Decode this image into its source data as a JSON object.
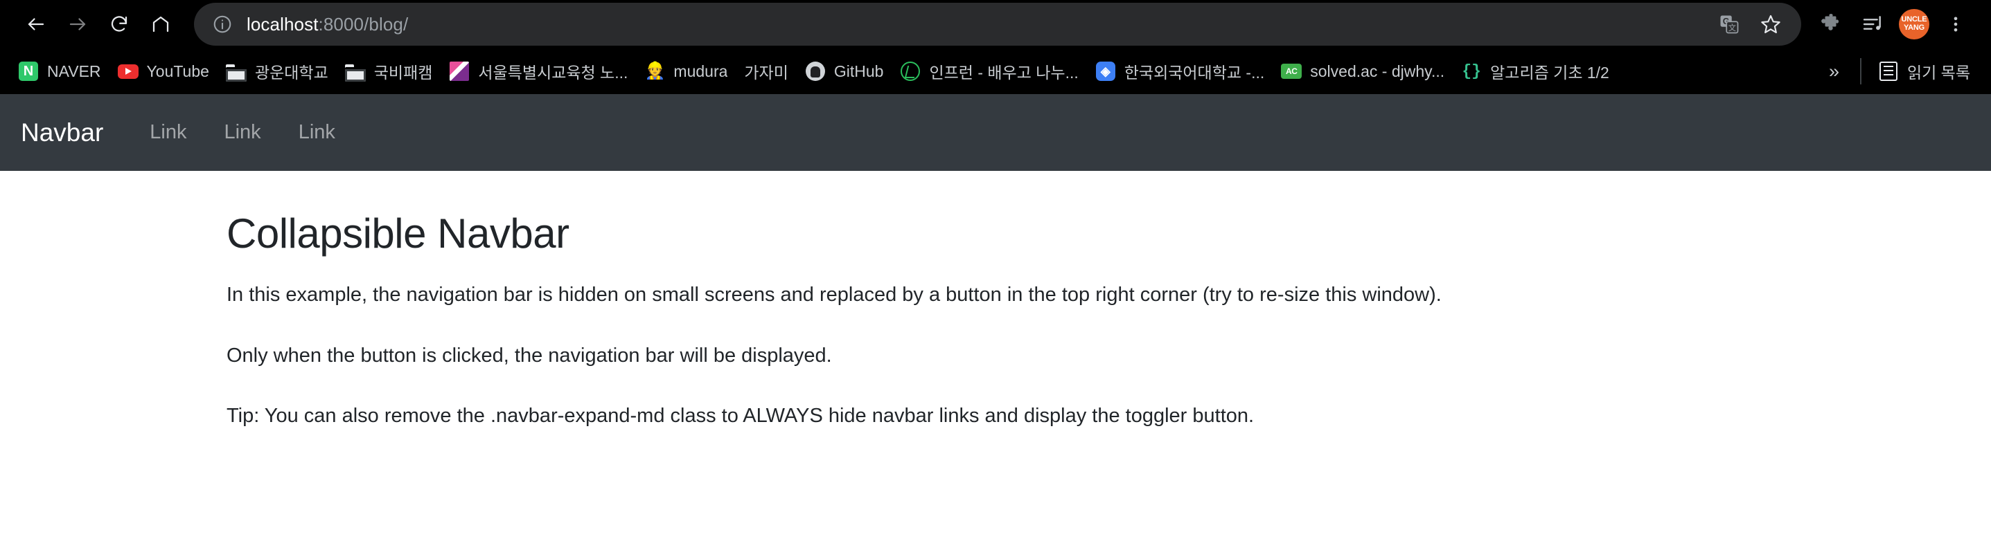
{
  "browser": {
    "nav": {
      "back": "Back",
      "forward": "Forward",
      "reload": "Reload",
      "home": "Home"
    },
    "omnibox": {
      "site_info": "Site information",
      "host": "localhost",
      "path": ":8000/blog/",
      "translate": "Translate this page",
      "bookmark": "Bookmark this tab"
    },
    "toolbar_right": {
      "extensions": "Extensions",
      "media": "Media controls",
      "profile_line1": "UNCLE",
      "profile_line2": "YANG",
      "menu": "Customize and control Google Chrome"
    },
    "bookmarks": [
      {
        "label": "NAVER",
        "icon": "naver-favicon"
      },
      {
        "label": "YouTube",
        "icon": "youtube-favicon"
      },
      {
        "label": "광운대학교",
        "icon": "folder-icon"
      },
      {
        "label": "국비패캠",
        "icon": "folder-icon"
      },
      {
        "label": "서울특별시교육청 노...",
        "icon": "seoul-education-favicon"
      },
      {
        "label": "mudura",
        "icon": "construction-worker-emoji"
      },
      {
        "label": "가자미",
        "icon": "none"
      },
      {
        "label": "GitHub",
        "icon": "github-favicon"
      },
      {
        "label": "인프런 - 배우고 나누...",
        "icon": "inflearn-favicon"
      },
      {
        "label": "한국외국어대학교 -...",
        "icon": "hufs-favicon"
      },
      {
        "label": "solved.ac - djwhy...",
        "icon": "solvedac-favicon"
      },
      {
        "label": "알고리즘 기초 1/2",
        "icon": "braces-favicon"
      }
    ],
    "bookmarks_overflow": "»",
    "reading_list": {
      "label": "읽기 목록",
      "icon": "reading-list-icon"
    }
  },
  "page": {
    "navbar": {
      "brand": "Navbar",
      "links": [
        "Link",
        "Link",
        "Link"
      ],
      "background_color": "#343a40"
    },
    "heading": "Collapsible Navbar",
    "paragraphs": [
      "In this example, the navigation bar is hidden on small screens and replaced by a button in the top right corner (try to re-size this window).",
      "Only when the button is clicked, the navigation bar will be displayed.",
      "Tip: You can also remove the .navbar-expand-md class to ALWAYS hide navbar links and display the toggler button."
    ]
  }
}
